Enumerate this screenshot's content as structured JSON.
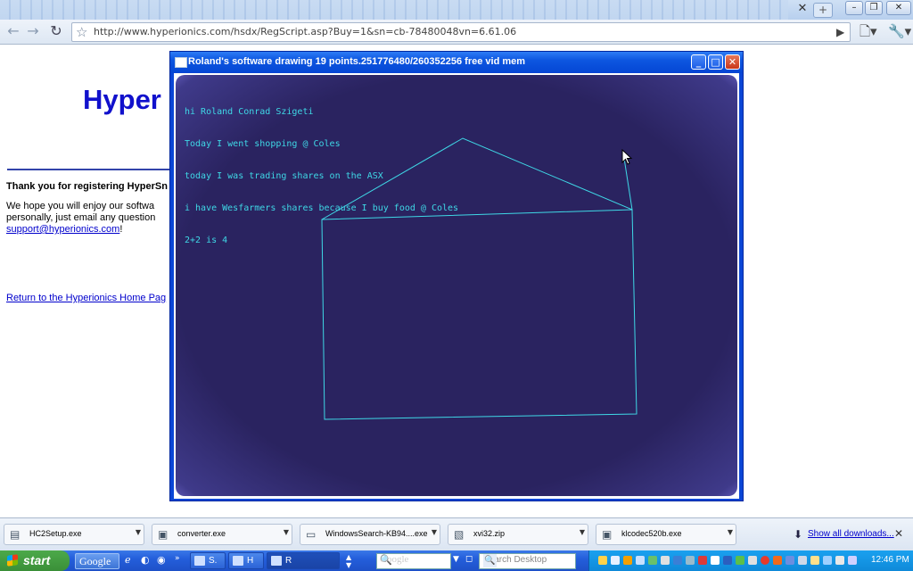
{
  "browser": {
    "url": "http://www.hyperionics.com/hsdx/RegScript.asp?Buy=1&sn=cb-78480048vn=6.61.06"
  },
  "webpage": {
    "heading": "Hyper",
    "thanks_line": "Thank you for registering HyperSn",
    "paragraph_line1": "We hope you will enjoy our softwa",
    "paragraph_line2": "personally, just email any question",
    "support_link": "support@hyperionics.com",
    "support_suffix": "!",
    "home_link": "Return to the Hyperionics Home Pag"
  },
  "app_window": {
    "title": "Roland's software drawing 19 points.251776480/260352256 free vid mem",
    "console_lines": [
      "hi Roland Conrad Szigeti",
      "Today I went shopping @ Coles",
      "today I was trading shares on the ASX",
      "i have Wesfarmers shares because I buy food @ Coles",
      "2+2 is 4"
    ],
    "line_color": "#3fd8e6",
    "background_color": "#2a2360"
  },
  "downloads": {
    "items": [
      {
        "name": "HC2Setup.exe",
        "icon": "archive-icon"
      },
      {
        "name": "converter.exe",
        "icon": "installer-icon"
      },
      {
        "name": "WindowsSearch-KB94....exe",
        "icon": "window-icon"
      },
      {
        "name": "xvi32.zip",
        "icon": "zip-icon"
      },
      {
        "name": "klcodec520b.exe",
        "icon": "installer-icon"
      }
    ],
    "show_all": "Show all downloads..."
  },
  "taskbar": {
    "start_label": "start",
    "google_label": "Google",
    "tasks": [
      {
        "label": "S."
      },
      {
        "label": "H"
      },
      {
        "label": "R"
      }
    ],
    "google_search_text": "Google",
    "desktop_search_placeholder": "Search Desktop",
    "clock": "12:46 PM"
  }
}
